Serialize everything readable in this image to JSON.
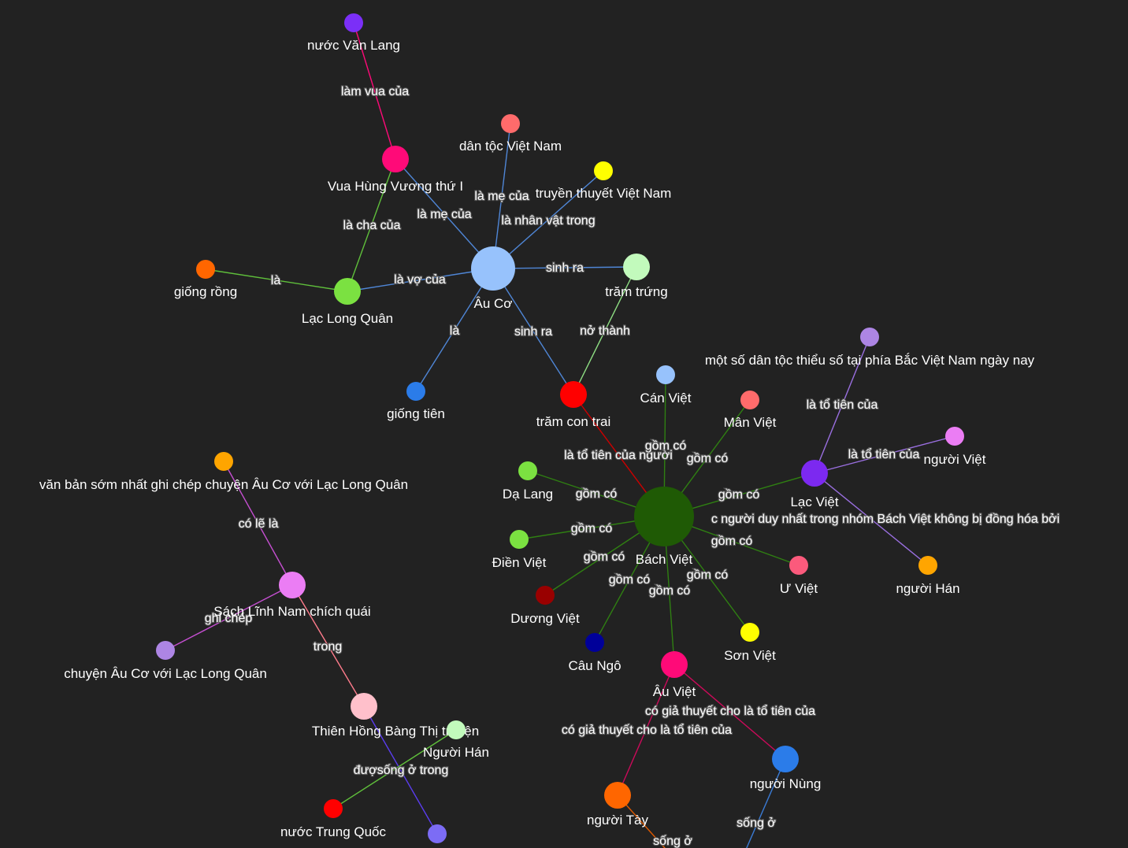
{
  "graph": {
    "nodes": [
      {
        "id": "nuoc_van_lang",
        "label": "nước Văn Lang",
        "color": "#7b2ff7",
        "size": "s"
      },
      {
        "id": "vua_hung",
        "label": "Vua Hùng Vương thứ I",
        "color": "#ff0a78",
        "size": "m"
      },
      {
        "id": "dan_toc_vn",
        "label": "dân tộc Việt Nam",
        "color": "#ff6b6b",
        "size": "s"
      },
      {
        "id": "truyen_thuyet",
        "label": "truyền thuyết Việt Nam",
        "color": "#ffff00",
        "size": "s"
      },
      {
        "id": "au_co",
        "label": "Âu Cơ",
        "color": "#97c2fc",
        "size": "l"
      },
      {
        "id": "giong_rong",
        "label": "giống rồng",
        "color": "#ff6600",
        "size": "s"
      },
      {
        "id": "lac_long_quan",
        "label": "Lạc Long Quân",
        "color": "#7be141",
        "size": "m"
      },
      {
        "id": "tram_trung",
        "label": "trăm trứng",
        "color": "#c2fabc",
        "size": "m"
      },
      {
        "id": "giong_tien",
        "label": "giống tiên",
        "color": "#2b7ce9",
        "size": "s"
      },
      {
        "id": "tram_con_trai",
        "label": "trăm con trai",
        "color": "#ff0000",
        "size": "m"
      },
      {
        "id": "can_viet",
        "label": "Cán Việt",
        "color": "#97c2fc",
        "size": "s"
      },
      {
        "id": "man_viet",
        "label": "Mân Việt",
        "color": "#ff6b6b",
        "size": "s"
      },
      {
        "id": "mot_so_dan_toc",
        "label": "một số dân tộc thiểu số tại phía Bắc Việt Nam ngày nay",
        "color": "#ad85e4",
        "size": "s"
      },
      {
        "id": "nguoi_viet",
        "label": "người Việt",
        "color": "#eb7df4",
        "size": "s"
      },
      {
        "id": "lac_viet",
        "label": "Lạc Việt",
        "color": "#7c29f0",
        "size": "m"
      },
      {
        "id": "nguoi_han",
        "label": "người Hán",
        "color": "#ffa500",
        "size": "s"
      },
      {
        "id": "bach_viet",
        "label": "Bách Việt",
        "color": "#1f5a05",
        "size": "xl"
      },
      {
        "id": "da_lang",
        "label": "Dạ Lang",
        "color": "#7be141",
        "size": "s"
      },
      {
        "id": "dien_viet",
        "label": "Điền Việt",
        "color": "#7be141",
        "size": "s"
      },
      {
        "id": "duong_viet",
        "label": "Dương Việt",
        "color": "#990000",
        "size": "s"
      },
      {
        "id": "cau_ngo",
        "label": "Câu Ngô",
        "color": "#000099",
        "size": "s"
      },
      {
        "id": "u_viet",
        "label": "Ư Việt",
        "color": "#fb5a7c",
        "size": "s"
      },
      {
        "id": "son_viet",
        "label": "Sơn Việt",
        "color": "#ffff00",
        "size": "s"
      },
      {
        "id": "au_viet",
        "label": "Âu Việt",
        "color": "#ff0a78",
        "size": "m"
      },
      {
        "id": "nguoi_nung",
        "label": "người Nùng",
        "color": "#2b7ce9",
        "size": "m"
      },
      {
        "id": "nguoi_tay",
        "label": "người Tày",
        "color": "#ff6600",
        "size": "m"
      },
      {
        "id": "van_ban_som",
        "label": "văn bản sớm nhất ghi chép chuyện Âu Cơ với Lạc Long Quân",
        "color": "#ffa500",
        "size": "s"
      },
      {
        "id": "linh_nam",
        "label": "Sách Lĩnh Nam chích quái",
        "color": "#eb7df4",
        "size": "m"
      },
      {
        "id": "chuyen_au_co",
        "label": "chuyện Âu Cơ với Lạc Long Quân",
        "color": "#ad85e4",
        "size": "s"
      },
      {
        "id": "thien_hong_bang",
        "label": "Thiên Hồng Bàng Thị truyện",
        "color": "#ffc0cb",
        "size": "m"
      },
      {
        "id": "nguoi_han2",
        "label": "Người Hán",
        "color": "#c2fabc",
        "size": "s"
      },
      {
        "id": "nuoc_trung_quoc",
        "label": "nước Trung Quốc",
        "color": "#ff0000",
        "size": "s"
      },
      {
        "id": "purple_bottom",
        "label": "",
        "color": "#7c6cf5",
        "size": "s"
      }
    ],
    "edges": [
      {
        "from": "vua_hung",
        "to": "nuoc_van_lang",
        "label": "làm vua của",
        "color": "#ff0a78"
      },
      {
        "from": "au_co",
        "to": "dan_toc_vn",
        "label": "là mẹ của",
        "color": "#4f86d6"
      },
      {
        "from": "au_co",
        "to": "vua_hung",
        "label": "là mẹ của",
        "color": "#4f86d6"
      },
      {
        "from": "au_co",
        "to": "truyen_thuyet",
        "label": "là nhân vật trong",
        "color": "#4f86d6"
      },
      {
        "from": "lac_long_quan",
        "to": "vua_hung",
        "label": "là cha của",
        "color": "#5fbf3b"
      },
      {
        "from": "lac_long_quan",
        "to": "giong_rong",
        "label": "là",
        "color": "#5fbf3b"
      },
      {
        "from": "au_co",
        "to": "lac_long_quan",
        "label": "là vợ của",
        "color": "#4f86d6"
      },
      {
        "from": "au_co",
        "to": "tram_trung",
        "label": "sinh ra",
        "color": "#4f86d6"
      },
      {
        "from": "au_co",
        "to": "giong_tien",
        "label": "là",
        "color": "#4f86d6"
      },
      {
        "from": "au_co",
        "to": "tram_con_trai",
        "label": "sinh ra",
        "color": "#4f86d6"
      },
      {
        "from": "tram_trung",
        "to": "tram_con_trai",
        "label": "nở thành",
        "color": "#8ede83"
      },
      {
        "from": "tram_con_trai",
        "to": "bach_viet",
        "label": "là tổ tiên của người",
        "color": "#cc0000"
      },
      {
        "from": "bach_viet",
        "to": "can_viet",
        "label": "gồm có",
        "color": "#2f7f12"
      },
      {
        "from": "bach_viet",
        "to": "man_viet",
        "label": "gồm có",
        "color": "#2f7f12"
      },
      {
        "from": "bach_viet",
        "to": "lac_viet",
        "label": "gồm có",
        "color": "#2f7f12"
      },
      {
        "from": "bach_viet",
        "to": "da_lang",
        "label": "gồm có",
        "color": "#2f7f12"
      },
      {
        "from": "bach_viet",
        "to": "dien_viet",
        "label": "gồm có",
        "color": "#2f7f12"
      },
      {
        "from": "bach_viet",
        "to": "duong_viet",
        "label": "gồm có",
        "color": "#2f7f12"
      },
      {
        "from": "bach_viet",
        "to": "cau_ngo",
        "label": "gồm có",
        "color": "#2f7f12"
      },
      {
        "from": "bach_viet",
        "to": "au_viet",
        "label": "gồm có",
        "color": "#2f7f12"
      },
      {
        "from": "bach_viet",
        "to": "son_viet",
        "label": "gồm có",
        "color": "#2f7f12"
      },
      {
        "from": "bach_viet",
        "to": "u_viet",
        "label": "gồm có",
        "color": "#2f7f12"
      },
      {
        "from": "lac_viet",
        "to": "mot_so_dan_toc",
        "label": "là tổ tiên của",
        "color": "#9a6fe0"
      },
      {
        "from": "lac_viet",
        "to": "nguoi_viet",
        "label": "là tổ tiên của",
        "color": "#9a6fe0"
      },
      {
        "from": "lac_viet",
        "to": "nguoi_han",
        "label": "c người duy nhất trong nhóm Bách Việt không bị đồng hóa bởi",
        "color": "#9a6fe0"
      },
      {
        "from": "au_viet",
        "to": "nguoi_nung",
        "label": "có giả thuyết cho là tổ tiên của",
        "color": "#cc0a5a"
      },
      {
        "from": "au_viet",
        "to": "nguoi_tay",
        "label": "có giả thuyết cho là tổ tiên của",
        "color": "#cc0a5a"
      },
      {
        "from": "nguoi_tay",
        "to": "offscreen_a",
        "label": "sống ở",
        "color": "#e05a00"
      },
      {
        "from": "nguoi_nung",
        "to": "offscreen_b",
        "label": "sống ở",
        "color": "#3a7bd5"
      },
      {
        "from": "van_ban_som",
        "to": "linh_nam",
        "label": "có lẽ là",
        "color": "#c54fd1"
      },
      {
        "from": "linh_nam",
        "to": "chuyen_au_co",
        "label": "ghi chép",
        "color": "#c54fd1"
      },
      {
        "from": "thien_hong_bang",
        "to": "linh_nam",
        "label": "trong",
        "color": "#ff7c8c"
      },
      {
        "from": "thien_hong_bang",
        "to": "purple_bottom",
        "label": "",
        "color": "#5b3df0"
      },
      {
        "from": "nguoi_han2",
        "to": "nuoc_trung_quoc",
        "label": "đượsống ở trong",
        "color": "#5fbf3b"
      }
    ]
  }
}
